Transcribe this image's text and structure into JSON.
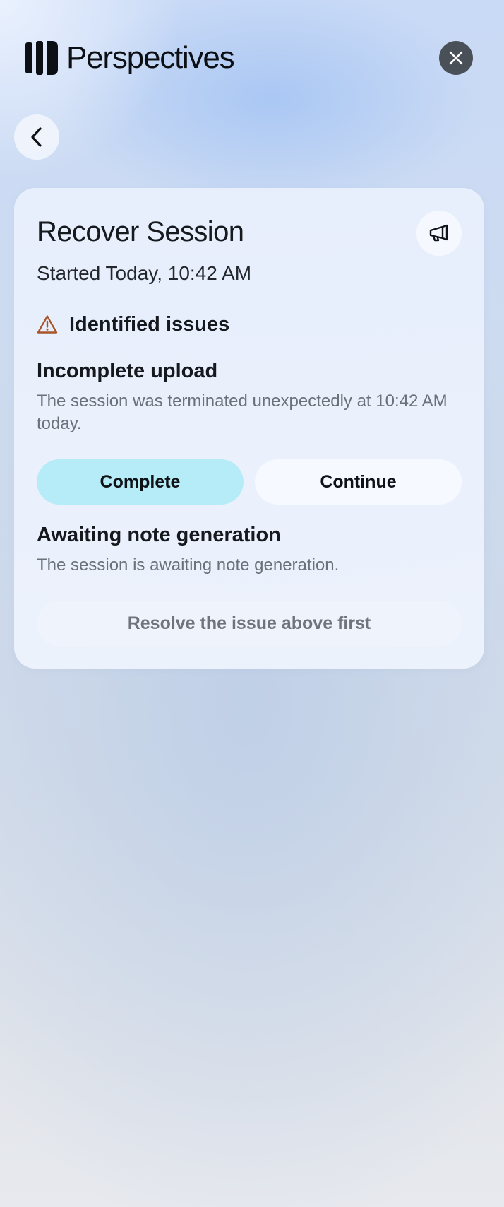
{
  "app": {
    "name": "Perspectives"
  },
  "header": {
    "close_icon": "close-icon",
    "back_icon": "chevron-left-icon"
  },
  "card": {
    "title": "Recover Session",
    "subtitle": "Started Today, 10:42 AM",
    "feedback_icon": "megaphone-icon",
    "issues_heading": "Identified issues",
    "issues_icon": "warning-icon",
    "issues": [
      {
        "title": "Incomplete upload",
        "description": "The session was terminated unexpectedly at 10:42 AM today.",
        "actions": [
          {
            "label": "Complete"
          },
          {
            "label": "Continue"
          }
        ]
      },
      {
        "title": "Awaiting note generation",
        "description": "The session is awaiting note generation.",
        "action_label": "Resolve the issue above first"
      }
    ]
  },
  "colors": {
    "accent_button": "#b6ecf7",
    "warning": "#a8552a",
    "close_button": "#4a5058"
  }
}
